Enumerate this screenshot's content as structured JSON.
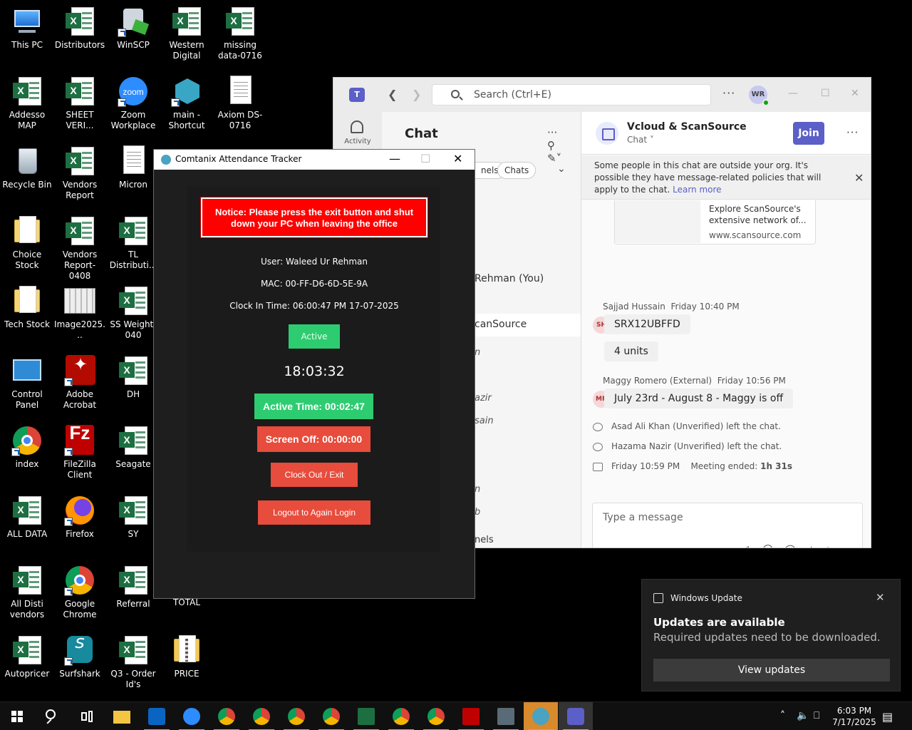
{
  "desktop": {
    "icons": [
      {
        "label": "This PC",
        "type": "pc"
      },
      {
        "label": "Distributors",
        "type": "excel"
      },
      {
        "label": "WinSCP",
        "type": "winscp"
      },
      {
        "label": "Western Digital",
        "type": "excel"
      },
      {
        "label": "missing data-0716",
        "type": "excel"
      },
      {
        "label": "Addesso MAP",
        "type": "excel"
      },
      {
        "label": "SHEET VERI...",
        "type": "excel"
      },
      {
        "label": "Zoom Workplace",
        "type": "zoom"
      },
      {
        "label": "main - Shortcut",
        "type": "hex"
      },
      {
        "label": "Axiom DS-0716",
        "type": "doc"
      },
      {
        "label": "Recycle Bin",
        "type": "bin"
      },
      {
        "label": "Vendors Report",
        "type": "excel"
      },
      {
        "label": "Micron",
        "type": "doc"
      },
      {
        "label": "Choice Stock",
        "type": "folder"
      },
      {
        "label": "Vendors Report-0408",
        "type": "excel"
      },
      {
        "label": "TL Distributi...",
        "type": "excel"
      },
      {
        "label": "Tech Stock",
        "type": "folder"
      },
      {
        "label": "Image2025...",
        "type": "image"
      },
      {
        "label": "SS Weight-040",
        "type": "excel"
      },
      {
        "label": "Control Panel",
        "type": "control"
      },
      {
        "label": "Adobe Acrobat",
        "type": "acrobat"
      },
      {
        "label": "DH",
        "type": "excel"
      },
      {
        "label": "index",
        "type": "chrome"
      },
      {
        "label": "FileZilla Client",
        "type": "filezilla"
      },
      {
        "label": "Seagate",
        "type": "excel"
      },
      {
        "label": "ALL DATA",
        "type": "excel"
      },
      {
        "label": "Firefox",
        "type": "firefox"
      },
      {
        "label": "SY",
        "type": "excel"
      },
      {
        "label": "All Disti vendors",
        "type": "excel"
      },
      {
        "label": "Google Chrome",
        "type": "chrome"
      },
      {
        "label": "Referral",
        "type": "excel"
      },
      {
        "label": "TOTAL",
        "type": "none"
      },
      {
        "label": "Autopricer",
        "type": "excel"
      },
      {
        "label": "Surfshark",
        "type": "surfshark"
      },
      {
        "label": "Q3 - Order Id's",
        "type": "excel"
      },
      {
        "label": "PRICE",
        "type": "zip"
      }
    ]
  },
  "teams": {
    "search_placeholder": "Search (Ctrl+E)",
    "avatar_initials": "WR",
    "rail_activity": "Activity",
    "chat_title": "Chat",
    "chips": [
      "nels",
      "Chats"
    ],
    "list_rows": [
      "Rehman (You)",
      "canSource"
    ],
    "list_fragments": [
      "n",
      "azir",
      "sain",
      "n",
      "b"
    ],
    "list_footer": "nels",
    "conversation": {
      "title": "Vcloud & ScanSource",
      "subtitle": "Chat",
      "join_label": "Join",
      "banner_text": "Some people in this chat are outside your org. It's possible they have message-related policies that will apply to the chat.",
      "banner_link": "Learn more",
      "card_desc": "Explore ScanSource's extensive network of...",
      "card_url": "www.scansource.com",
      "messages": [
        {
          "author": "Sajjad Hussain",
          "time": "Friday 10:40 PM",
          "initials": "SH",
          "bubbles": [
            "SRX12UBFFD",
            "4 units"
          ]
        },
        {
          "author": "Maggy Romero (External)",
          "time": "Friday 10:56 PM",
          "initials": "MR",
          "bubbles": [
            "July 23rd - August 8 - Maggy is off"
          ]
        }
      ],
      "events": [
        "Asad Ali Khan (Unverified) left the chat.",
        "Hazama Nazir (Unverified) left the chat."
      ],
      "meeting_time": "Friday 10:59 PM",
      "meeting_text": "Meeting ended:",
      "meeting_duration": "1h 31s",
      "compose_placeholder": "Type a message"
    }
  },
  "tracker": {
    "title": "Comtanix Attendance Tracker",
    "notice": "Notice: Please press the exit button and shut down your PC when leaving the office",
    "user": "User: Waleed Ur  Rehman",
    "mac": "MAC: 00-FF-D6-6D-5E-9A",
    "clock_in": "Clock In Time: 06:00:47 PM 17-07-2025",
    "status": "Active",
    "clock": "18:03:32",
    "active_time": "Active Time: 00:02:47",
    "screen_off": "Screen Off: 00:00:00",
    "clock_out": "Clock Out / Exit",
    "logout": "Logout to Again Login"
  },
  "toast": {
    "app": "Windows Update",
    "title": "Updates are available",
    "body": "Required updates need to be downloaded.",
    "button": "View updates"
  },
  "taskbar": {
    "time": "6:03 PM",
    "date": "7/17/2025",
    "apps": [
      "start",
      "search",
      "task-view",
      "file-explorer",
      "outlook",
      "zoom",
      "chrome",
      "chrome-profile-1",
      "chrome-profile-2",
      "chrome-profile-3",
      "excel",
      "chrome-profile-4",
      "chrome-profile-5",
      "filezilla",
      "calculator",
      "attendance-tracker",
      "teams"
    ]
  }
}
